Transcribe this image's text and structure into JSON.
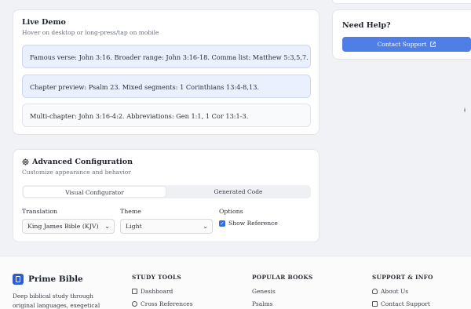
{
  "demo": {
    "title": "Live Demo",
    "subtitle": "Hover on desktop or long-press/tap on mobile",
    "rows": [
      "Famous verse: John 3:16. Broader range: John 3:16-18. Comma list: Matthew 5:3,5,7.",
      "Chapter preview: Psalm 23. Mixed segments: 1 Corinthians 13:4-8,13.",
      "Multi-chapter: John 3:16-4:2. Abbreviations: Gen 1:1, 1 Cor 13:1-3."
    ]
  },
  "help": {
    "title": "Need Help?",
    "button_label": "Contact Support",
    "button_icon": "external-link-icon"
  },
  "advanced": {
    "title": "Advanced Configuration",
    "subtitle": "Customize appearance and behavior",
    "title_icon": "gear-icon",
    "tabs": [
      "Visual Configurator",
      "Generated Code"
    ],
    "active_tab": "Visual Configurator",
    "translation_label": "Translation",
    "translation_value": "King James Bible (KJV)",
    "theme_label": "Theme",
    "theme_value": "Light",
    "options_label": "Options",
    "show_reference_label": "Show Reference",
    "show_reference_checked": true
  },
  "footer": {
    "brand": "Prime Bible",
    "description": "Deep biblical study through original languages, exegetical analysis, and",
    "columns": [
      {
        "heading": "STUDY TOOLS",
        "links": [
          "Dashboard",
          "Cross References"
        ]
      },
      {
        "heading": "POPULAR BOOKS",
        "links": [
          "Genesis",
          "Psalms"
        ]
      },
      {
        "heading": "SUPPORT & INFO",
        "links": [
          "About Us",
          "Contact Support"
        ]
      }
    ]
  },
  "colors": {
    "accent": "#4f7fe6",
    "highlight_bg": "#eaf0fd",
    "brand": "#2d5bd1"
  }
}
